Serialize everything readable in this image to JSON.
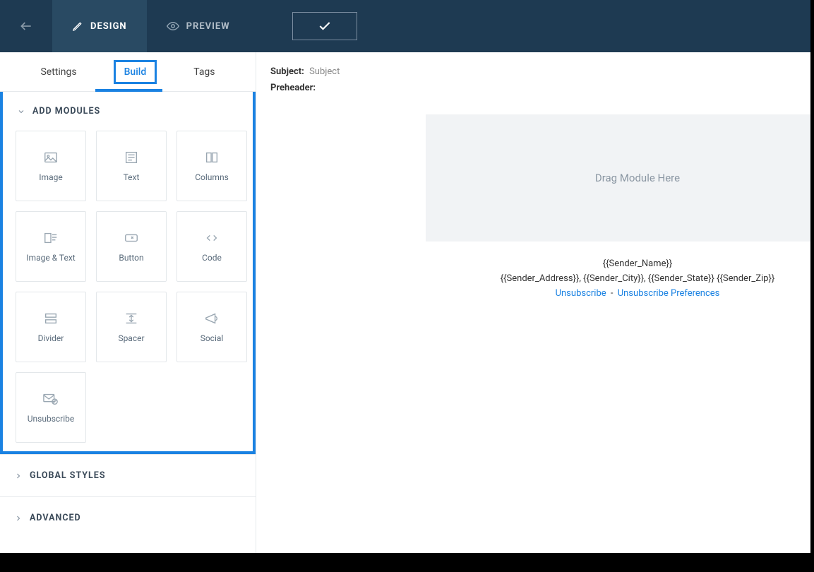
{
  "topbar": {
    "design_label": "DESIGN",
    "preview_label": "PREVIEW"
  },
  "subtabs": {
    "settings": "Settings",
    "build": "Build",
    "tags": "Tags"
  },
  "sections": {
    "add_modules": "ADD MODULES",
    "global_styles": "GLOBAL STYLES",
    "advanced": "ADVANCED"
  },
  "modules": [
    {
      "id": "image",
      "label": "Image"
    },
    {
      "id": "text",
      "label": "Text"
    },
    {
      "id": "columns",
      "label": "Columns"
    },
    {
      "id": "image-text",
      "label": "Image & Text"
    },
    {
      "id": "button",
      "label": "Button"
    },
    {
      "id": "code",
      "label": "Code"
    },
    {
      "id": "divider",
      "label": "Divider"
    },
    {
      "id": "spacer",
      "label": "Spacer"
    },
    {
      "id": "social",
      "label": "Social"
    },
    {
      "id": "unsubscribe",
      "label": "Unsubscribe"
    }
  ],
  "canvas": {
    "subject_label": "Subject:",
    "subject_value": "Subject",
    "preheader_label": "Preheader:",
    "dropzone_text": "Drag Module Here",
    "footer": {
      "sender_name": "{{Sender_Name}}",
      "sender_address_line": "{{Sender_Address}}, {{Sender_City}}, {{Sender_State}} {{Sender_Zip}}",
      "unsubscribe": "Unsubscribe",
      "separator": "-",
      "unsubscribe_prefs": "Unsubscribe Preferences"
    }
  }
}
